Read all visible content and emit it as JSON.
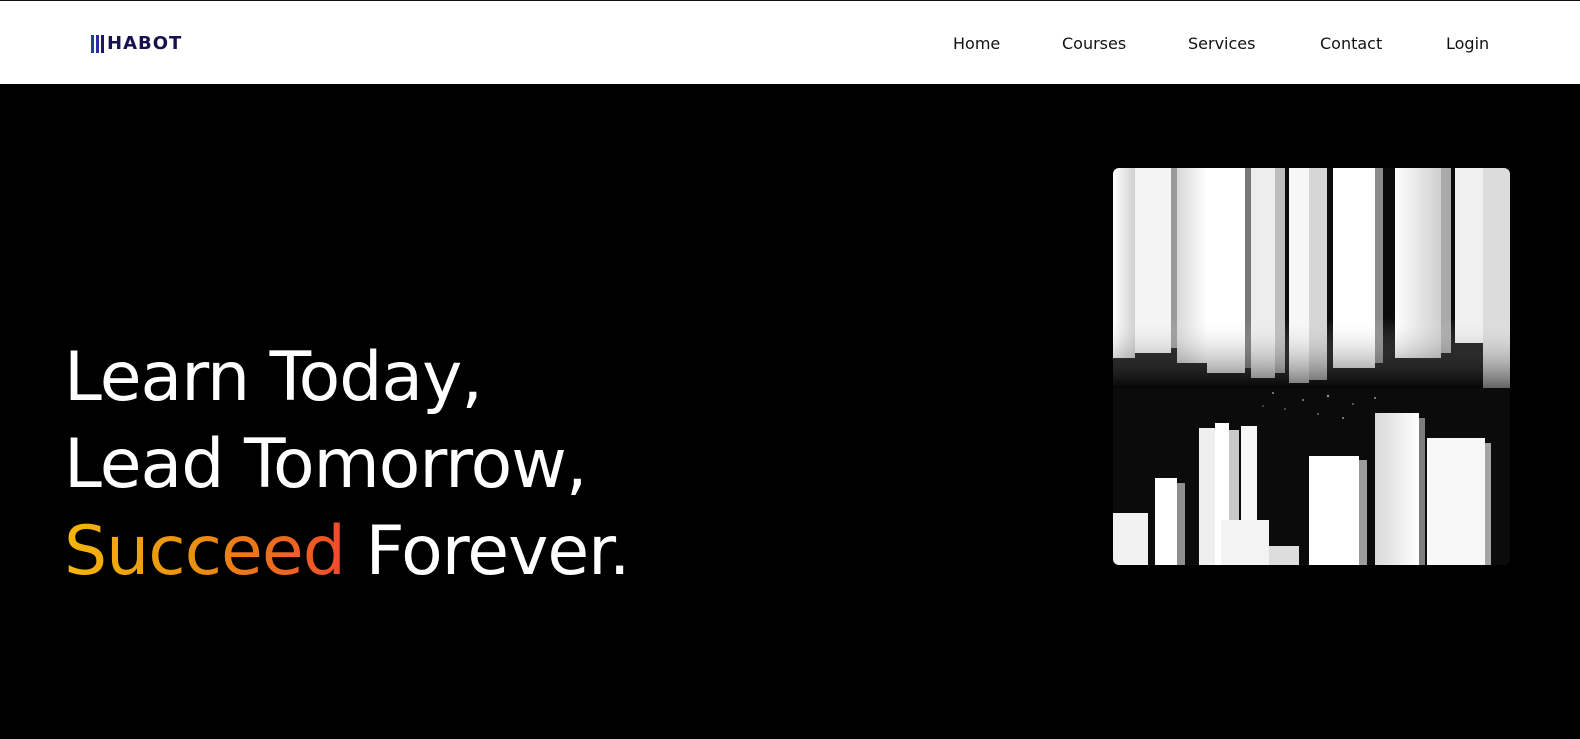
{
  "logo": {
    "text": "HABOT",
    "icon": "stacked-bars-logo",
    "colors": [
      "#1f3f8f",
      "#2d2aa5",
      "#1a1a5e"
    ],
    "text_color": "#15124d"
  },
  "nav": {
    "items": [
      {
        "label": "Home"
      },
      {
        "label": "Courses"
      },
      {
        "label": "Services"
      },
      {
        "label": "Contact"
      },
      {
        "label": "Login"
      }
    ]
  },
  "hero": {
    "line1": "Learn Today,",
    "line2": "Lead Tomorrow,",
    "line3_accent": "Succeed",
    "line3_rest": " Forever.",
    "accent_gradient": [
      "#f5b70a",
      "#e99210",
      "#f04b2c"
    ],
    "image": "black-and-white books photograph"
  }
}
